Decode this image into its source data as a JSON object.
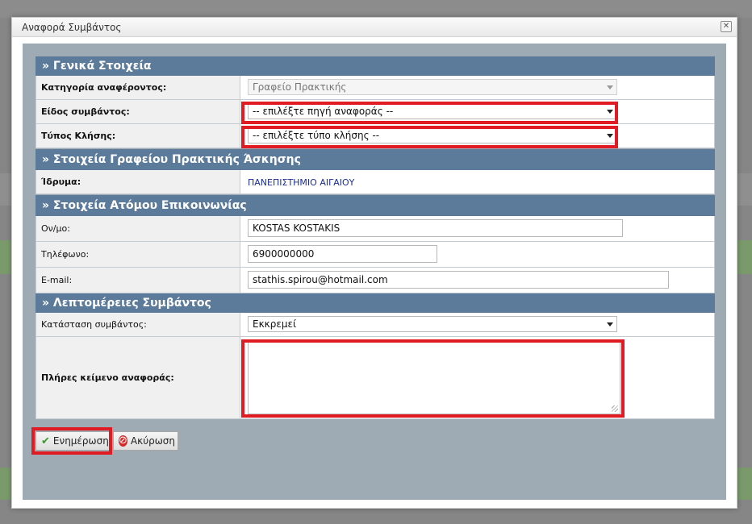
{
  "dialog": {
    "title": "Αναφορά Συμβάντος"
  },
  "sections": {
    "general": "» Γενικά Στοιχεία",
    "office": "» Στοιχεία Γραφείου Πρακτικής Άσκησης",
    "contact": "» Στοιχεία Ατόμου Επικοινωνίας",
    "details": "» Λεπτομέρειες Συμβάντος"
  },
  "general": {
    "reporter_category_label": "Κατηγορία αναφέροντος:",
    "reporter_category_value": "Γραφείο Πρακτικής",
    "incident_type_label": "Είδος συμβάντος:",
    "incident_type_value": "-- επιλέξτε πηγή αναφοράς --",
    "call_type_label": "Τύπος Κλήσης:",
    "call_type_value": "-- επιλέξτε τύπο κλήσης --"
  },
  "office": {
    "institution_label": "Ίδρυμα:",
    "institution_value": "ΠΑΝΕΠΙΣΤΗΜΙΟ ΑΙΓΑΙΟΥ"
  },
  "contact": {
    "name_label": "Ον/μο:",
    "name_value": "KOSTAS KOSTAKIS",
    "phone_label": "Τηλέφωνο:",
    "phone_value": "6900000000",
    "email_label": "E-mail:",
    "email_value": "stathis.spirou@hotmail.com"
  },
  "details": {
    "status_label": "Κατάσταση συμβάντος:",
    "status_value": "Εκκρεμεί",
    "full_text_label": "Πλήρες κείμενο αναφοράς:",
    "full_text_value": ""
  },
  "buttons": {
    "update": "Ενημέρωση",
    "cancel": "Ακύρωση"
  },
  "colors": {
    "section_header": "#5c7a99",
    "highlight": "#e01b24",
    "content_bg": "#9eabb5"
  }
}
